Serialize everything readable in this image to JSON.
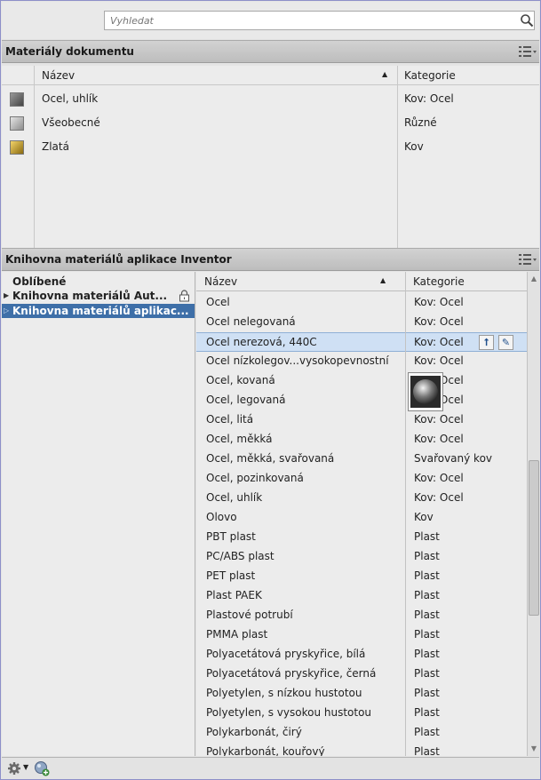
{
  "search": {
    "placeholder": "Vyhledat"
  },
  "document_materials": {
    "title": "Materiály dokumentu",
    "columns": {
      "name": "Název",
      "category": "Kategorie"
    },
    "rows": [
      {
        "name": "Ocel, uhlík",
        "category": "Kov: Ocel",
        "swatch": "#6c6c6c"
      },
      {
        "name": "Všeobecné",
        "category": "Různé",
        "swatch": "#b9b9b9"
      },
      {
        "name": "Zlatá",
        "category": "Kov",
        "swatch": "#c9a227"
      }
    ]
  },
  "library": {
    "title": "Knihovna materiálů aplikace Inventor",
    "tree": {
      "favorites": "Oblíbené",
      "items": [
        {
          "label": "Knihovna materiálů Aut...",
          "locked": true,
          "selected": false
        },
        {
          "label": "Knihovna materiálů aplikac...",
          "locked": false,
          "selected": true
        }
      ]
    },
    "columns": {
      "name": "Název",
      "category": "Kategorie"
    },
    "rows": [
      {
        "name": "Ocel",
        "category": "Kov: Ocel"
      },
      {
        "name": "Ocel nelegovaná",
        "category": "Kov: Ocel"
      },
      {
        "name": "Ocel nerezová, 440C",
        "category": "Kov: Ocel",
        "highlighted": true
      },
      {
        "name": "Ocel nízkolegov...vysokopevnostní",
        "category": "Kov: Ocel"
      },
      {
        "name": "Ocel, kovaná",
        "category": "Kov: Ocel"
      },
      {
        "name": "Ocel, legovaná",
        "category": "Kov: Ocel"
      },
      {
        "name": "Ocel, litá",
        "category": "Kov: Ocel"
      },
      {
        "name": "Ocel, měkká",
        "category": "Kov: Ocel"
      },
      {
        "name": "Ocel, měkká, svařovaná",
        "category": "Svařovaný kov"
      },
      {
        "name": "Ocel, pozinkovaná",
        "category": "Kov: Ocel"
      },
      {
        "name": "Ocel, uhlík",
        "category": "Kov: Ocel"
      },
      {
        "name": "Olovo",
        "category": "Kov"
      },
      {
        "name": "PBT plast",
        "category": "Plast"
      },
      {
        "name": "PC/ABS plast",
        "category": "Plast"
      },
      {
        "name": "PET plast",
        "category": "Plast"
      },
      {
        "name": "Plast PAEK",
        "category": "Plast"
      },
      {
        "name": "Plastové potrubí",
        "category": "Plast"
      },
      {
        "name": "PMMA plast",
        "category": "Plast"
      },
      {
        "name": "Polyacetátová pryskyřice, bílá",
        "category": "Plast"
      },
      {
        "name": "Polyacetátová pryskyřice, černá",
        "category": "Plast"
      },
      {
        "name": "Polyetylen, s nízkou hustotou",
        "category": "Plast"
      },
      {
        "name": "Polyetylen, s vysokou hustotou",
        "category": "Plast"
      },
      {
        "name": "Polykarbonát, čirý",
        "category": "Plast"
      },
      {
        "name": "Polykarbonát, kouřový",
        "category": "Plast"
      }
    ],
    "row_buttons": {
      "add": "⭡",
      "edit": "✎"
    },
    "scroll_fraction": 0.53
  },
  "icons": {
    "search": "search-icon",
    "view_options": "list-view-icon",
    "lock": "lock-icon",
    "gear": "gear-icon",
    "add_material": "add-material-icon"
  },
  "colors": {
    "selection": "#3e6fa8",
    "highlight": "#cfe0f4",
    "frame": "#8d8fc9"
  }
}
